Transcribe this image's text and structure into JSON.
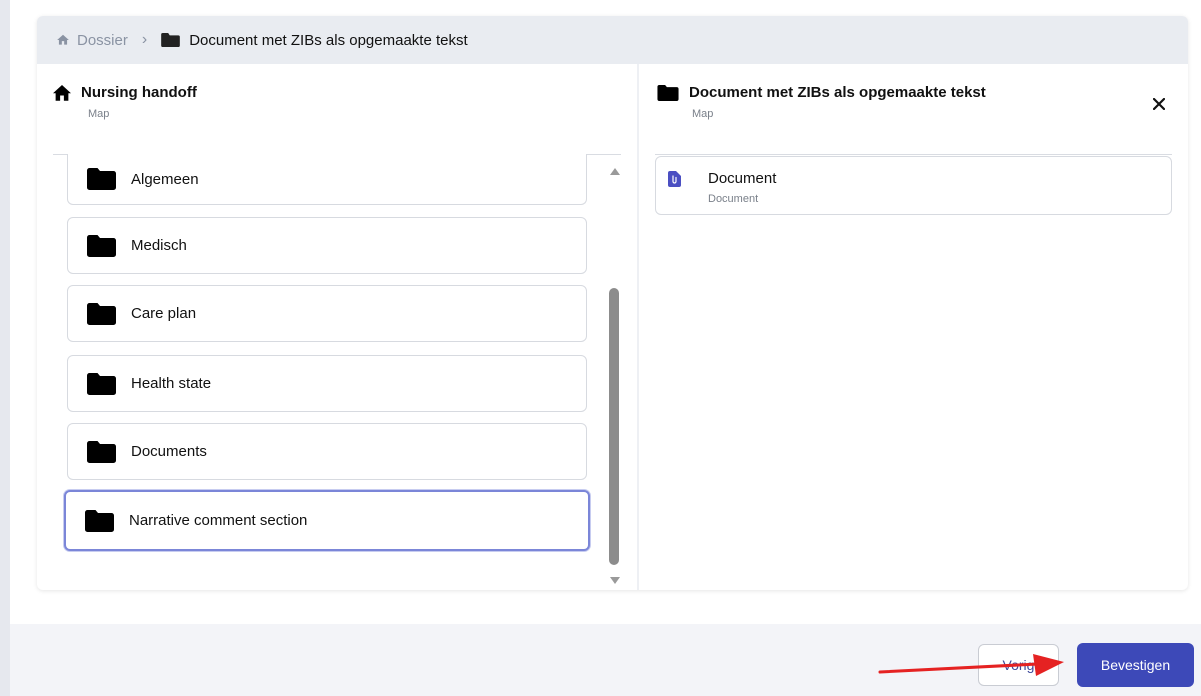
{
  "breadcrumb": {
    "root_label": "Dossier",
    "separator": "›",
    "current_label": "Document met ZIBs als opgemaakte tekst"
  },
  "left_panel": {
    "title": "Nursing handoff",
    "subtitle": "Map",
    "items": [
      {
        "label": "Algemeen"
      },
      {
        "label": "Medisch"
      },
      {
        "label": "Care plan"
      },
      {
        "label": "Health state"
      },
      {
        "label": "Documents"
      },
      {
        "label": "Narrative comment section",
        "selected": true
      }
    ]
  },
  "right_panel": {
    "title": "Document met ZIBs als opgemaakte tekst",
    "subtitle": "Map",
    "items": [
      {
        "label": "Document",
        "type": "Document"
      }
    ]
  },
  "footer": {
    "prev_label": "Vorig",
    "confirm_label": "Bevestigen"
  },
  "colors": {
    "accent": "#3d49b8",
    "selection_border": "#7b86d8",
    "annotation_arrow": "#e52222"
  },
  "icons": [
    "home-icon",
    "folder-icon",
    "close-icon",
    "document-file-icon"
  ]
}
